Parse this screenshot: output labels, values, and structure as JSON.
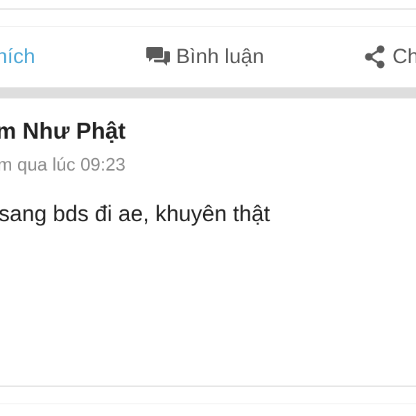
{
  "actions": {
    "like_label": "hích",
    "comment_label": "Bình luận",
    "share_label": "Ch"
  },
  "icons": {
    "comment": "comment-bubbles-icon",
    "share": "share-icon"
  },
  "colors": {
    "like_accent": "#4aa6d6",
    "text_primary": "#222222",
    "text_muted": "#8a8a8a",
    "action_text": "#555555",
    "separator": "#dedede"
  },
  "post": {
    "author": "m Như Phật",
    "timestamp": "m qua lúc 09:23",
    "content": "sang bds đi ae, khuyên thật"
  }
}
